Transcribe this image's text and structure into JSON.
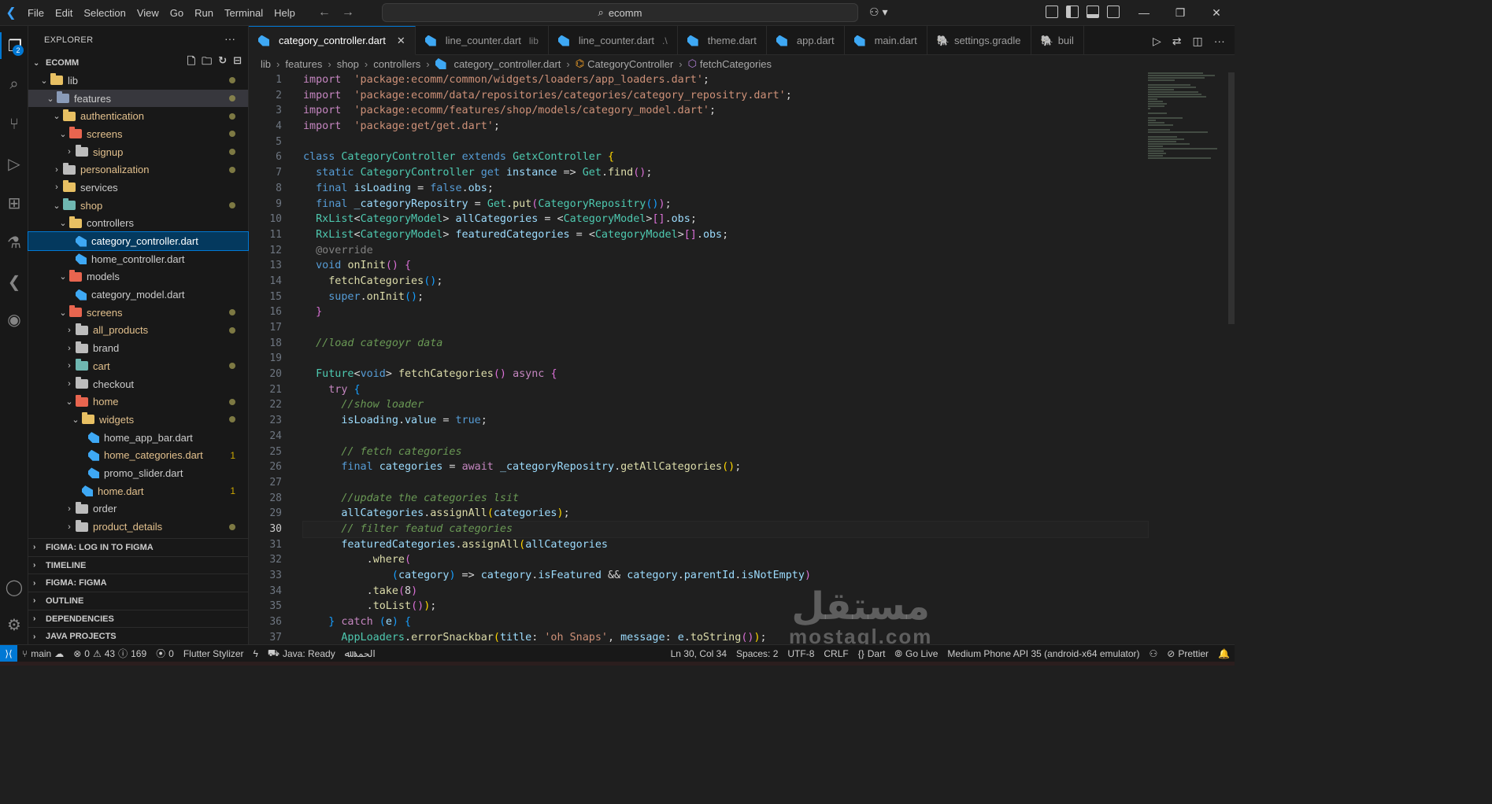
{
  "menu": [
    "File",
    "Edit",
    "Selection",
    "View",
    "Go",
    "Run",
    "Terminal",
    "Help"
  ],
  "search": {
    "text": "ecomm"
  },
  "explorer": {
    "title": "EXPLORER",
    "root": "ECOMM",
    "tree": [
      {
        "label": "lib",
        "type": "folder",
        "depth": 1,
        "open": true,
        "color": "#e8c063",
        "dot": true
      },
      {
        "label": "features",
        "type": "folder",
        "depth": 2,
        "open": true,
        "color": "#8a9bb8",
        "dot": true,
        "hl": true
      },
      {
        "label": "authentication",
        "type": "folder",
        "depth": 3,
        "open": true,
        "color": "#e8c063",
        "dot": true,
        "yellow": true
      },
      {
        "label": "screens",
        "type": "folder",
        "depth": 4,
        "open": true,
        "color": "#e8654f",
        "dot": true,
        "yellow": true
      },
      {
        "label": "signup",
        "type": "folder",
        "depth": 5,
        "open": false,
        "color": "#bcbcbc",
        "dot": true,
        "yellow": true
      },
      {
        "label": "personalization",
        "type": "folder",
        "depth": 3,
        "open": false,
        "color": "#bcbcbc",
        "dot": true,
        "yellow": true
      },
      {
        "label": "services",
        "type": "folder",
        "depth": 3,
        "open": false,
        "color": "#e8c063",
        "dot": false
      },
      {
        "label": "shop",
        "type": "folder",
        "depth": 3,
        "open": true,
        "color": "#6fb7b1",
        "dot": true,
        "yellow": true
      },
      {
        "label": "controllers",
        "type": "folder",
        "depth": 4,
        "open": true,
        "color": "#e8c063",
        "dot": false
      },
      {
        "label": "category_controller.dart",
        "type": "file",
        "depth": 5,
        "selected": true
      },
      {
        "label": "home_controller.dart",
        "type": "file",
        "depth": 5
      },
      {
        "label": "models",
        "type": "folder",
        "depth": 4,
        "open": true,
        "color": "#e8654f",
        "dot": false
      },
      {
        "label": "category_model.dart",
        "type": "file",
        "depth": 5
      },
      {
        "label": "screens",
        "type": "folder",
        "depth": 4,
        "open": true,
        "color": "#e8654f",
        "dot": true,
        "yellow": true
      },
      {
        "label": "all_products",
        "type": "folder",
        "depth": 5,
        "open": false,
        "color": "#bcbcbc",
        "dot": true,
        "yellow": true
      },
      {
        "label": "brand",
        "type": "folder",
        "depth": 5,
        "open": false,
        "color": "#bcbcbc",
        "dot": false
      },
      {
        "label": "cart",
        "type": "folder",
        "depth": 5,
        "open": false,
        "color": "#6fb7b1",
        "dot": true,
        "yellow": true
      },
      {
        "label": "checkout",
        "type": "folder",
        "depth": 5,
        "open": false,
        "color": "#bcbcbc",
        "dot": false
      },
      {
        "label": "home",
        "type": "folder",
        "depth": 5,
        "open": true,
        "color": "#e8654f",
        "dot": true,
        "yellow": true
      },
      {
        "label": "widgets",
        "type": "folder",
        "depth": 6,
        "open": true,
        "color": "#e8c063",
        "dot": true,
        "yellow": true
      },
      {
        "label": "home_app_bar.dart",
        "type": "file",
        "depth": 7
      },
      {
        "label": "home_categories.dart",
        "type": "file",
        "depth": 7,
        "count": "1",
        "yellow": true
      },
      {
        "label": "promo_slider.dart",
        "type": "file",
        "depth": 7
      },
      {
        "label": "home.dart",
        "type": "file",
        "depth": 6,
        "count": "1",
        "yellow": true
      },
      {
        "label": "order",
        "type": "folder",
        "depth": 5,
        "open": false,
        "color": "#bcbcbc",
        "dot": false
      },
      {
        "label": "product_details",
        "type": "folder",
        "depth": 5,
        "open": false,
        "color": "#bcbcbc",
        "dot": true,
        "yellow": true
      }
    ],
    "sections": [
      "FIGMA: LOG IN TO FIGMA",
      "TIMELINE",
      "FIGMA: FIGMA",
      "OUTLINE",
      "DEPENDENCIES",
      "JAVA PROJECTS"
    ]
  },
  "activity_badge": "2",
  "tabs": [
    {
      "label": "category_controller.dart",
      "active": true,
      "icon": "dart"
    },
    {
      "label": "line_counter.dart",
      "desc": "lib",
      "icon": "dart"
    },
    {
      "label": "line_counter.dart",
      "desc": ".\\",
      "icon": "dart"
    },
    {
      "label": "theme.dart",
      "icon": "dart"
    },
    {
      "label": "app.dart",
      "icon": "dart"
    },
    {
      "label": "main.dart",
      "icon": "dart"
    },
    {
      "label": "settings.gradle",
      "icon": "gradle"
    },
    {
      "label": "buil",
      "icon": "gradle"
    }
  ],
  "breadcrumb": [
    "lib",
    "features",
    "shop",
    "controllers",
    "category_controller.dart",
    "CategoryController",
    "fetchCategories"
  ],
  "code": {
    "current_line": 30,
    "lines": [
      [
        [
          "kw2",
          "import"
        ],
        [
          "",
          "  "
        ],
        [
          "str",
          "'package:ecomm/common/widgets/loaders/app_loaders.dart'"
        ],
        [
          "",
          ";"
        ]
      ],
      [
        [
          "kw2",
          "import"
        ],
        [
          "",
          "  "
        ],
        [
          "str",
          "'package:ecomm/data/repositories/categories/category_repositry.dart'"
        ],
        [
          "",
          ";"
        ]
      ],
      [
        [
          "kw2",
          "import"
        ],
        [
          "",
          "  "
        ],
        [
          "str",
          "'package:ecomm/features/shop/models/category_model.dart'"
        ],
        [
          "",
          ";"
        ]
      ],
      [
        [
          "kw2",
          "import"
        ],
        [
          "",
          "  "
        ],
        [
          "str",
          "'package:get/get.dart'"
        ],
        [
          "",
          ";"
        ]
      ],
      [],
      [
        [
          "kw",
          "class"
        ],
        [
          "",
          " "
        ],
        [
          "ty",
          "CategoryController"
        ],
        [
          "",
          " "
        ],
        [
          "kw",
          "extends"
        ],
        [
          "",
          " "
        ],
        [
          "ty",
          "GetxController"
        ],
        [
          "",
          " "
        ],
        [
          "br1",
          "{"
        ]
      ],
      [
        [
          "",
          "  "
        ],
        [
          "kw",
          "static"
        ],
        [
          "",
          " "
        ],
        [
          "ty",
          "CategoryController"
        ],
        [
          "",
          " "
        ],
        [
          "kw",
          "get"
        ],
        [
          "",
          " "
        ],
        [
          "vr",
          "instance"
        ],
        [
          "",
          " => "
        ],
        [
          "ty",
          "Get"
        ],
        [
          "",
          "."
        ],
        [
          "fn",
          "find"
        ],
        [
          "br2",
          "()"
        ],
        [
          "",
          ";"
        ]
      ],
      [
        [
          "",
          "  "
        ],
        [
          "kw",
          "final"
        ],
        [
          "",
          " "
        ],
        [
          "vr",
          "isLoading"
        ],
        [
          "",
          " = "
        ],
        [
          "kw",
          "false"
        ],
        [
          "",
          "."
        ],
        [
          "vr",
          "obs"
        ],
        [
          "",
          ";"
        ]
      ],
      [
        [
          "",
          "  "
        ],
        [
          "kw",
          "final"
        ],
        [
          "",
          " "
        ],
        [
          "vr",
          "_categoryRepositry"
        ],
        [
          "",
          " = "
        ],
        [
          "ty",
          "Get"
        ],
        [
          "",
          "."
        ],
        [
          "fn",
          "put"
        ],
        [
          "br2",
          "("
        ],
        [
          "ty",
          "CategoryRepositry"
        ],
        [
          "br3",
          "()"
        ],
        [
          "br2",
          ")"
        ],
        [
          "",
          ";"
        ]
      ],
      [
        [
          "",
          "  "
        ],
        [
          "ty",
          "RxList"
        ],
        [
          "",
          "<"
        ],
        [
          "ty",
          "CategoryModel"
        ],
        [
          "",
          "> "
        ],
        [
          "vr",
          "allCategories"
        ],
        [
          "",
          " = "
        ],
        [
          "",
          "<"
        ],
        [
          "ty",
          "CategoryModel"
        ],
        [
          "",
          ">"
        ],
        [
          "br2",
          "[]"
        ],
        [
          "",
          "."
        ],
        [
          "vr",
          "obs"
        ],
        [
          "",
          ";"
        ]
      ],
      [
        [
          "",
          "  "
        ],
        [
          "ty",
          "RxList"
        ],
        [
          "",
          "<"
        ],
        [
          "ty",
          "CategoryModel"
        ],
        [
          "",
          "> "
        ],
        [
          "vr",
          "featuredCategories"
        ],
        [
          "",
          " = "
        ],
        [
          "",
          "<"
        ],
        [
          "ty",
          "CategoryModel"
        ],
        [
          "",
          ">"
        ],
        [
          "br2",
          "[]"
        ],
        [
          "",
          "."
        ],
        [
          "vr",
          "obs"
        ],
        [
          "",
          ";"
        ]
      ],
      [
        [
          "",
          "  "
        ],
        [
          "an",
          "@override"
        ]
      ],
      [
        [
          "",
          "  "
        ],
        [
          "kw",
          "void"
        ],
        [
          "",
          " "
        ],
        [
          "fn",
          "onInit"
        ],
        [
          "br2",
          "()"
        ],
        [
          "",
          " "
        ],
        [
          "br2",
          "{"
        ]
      ],
      [
        [
          "",
          "    "
        ],
        [
          "fn",
          "fetchCategories"
        ],
        [
          "br3",
          "()"
        ],
        [
          "",
          ";"
        ]
      ],
      [
        [
          "",
          "    "
        ],
        [
          "kw",
          "super"
        ],
        [
          "",
          "."
        ],
        [
          "fn",
          "onInit"
        ],
        [
          "br3",
          "()"
        ],
        [
          "",
          ";"
        ]
      ],
      [
        [
          "",
          "  "
        ],
        [
          "br2",
          "}"
        ]
      ],
      [],
      [
        [
          "",
          "  "
        ],
        [
          "cm",
          "//load categoyr data"
        ]
      ],
      [],
      [
        [
          "",
          "  "
        ],
        [
          "ty",
          "Future"
        ],
        [
          "",
          "<"
        ],
        [
          "kw",
          "void"
        ],
        [
          "",
          "> "
        ],
        [
          "fn",
          "fetchCategories"
        ],
        [
          "br2",
          "()"
        ],
        [
          "",
          " "
        ],
        [
          "kw2",
          "async"
        ],
        [
          "",
          " "
        ],
        [
          "br2",
          "{"
        ]
      ],
      [
        [
          "",
          "    "
        ],
        [
          "kw2",
          "try"
        ],
        [
          "",
          " "
        ],
        [
          "br3",
          "{"
        ]
      ],
      [
        [
          "",
          "      "
        ],
        [
          "cm",
          "//show loader"
        ]
      ],
      [
        [
          "",
          "      "
        ],
        [
          "vr",
          "isLoading"
        ],
        [
          "",
          "."
        ],
        [
          "vr",
          "value"
        ],
        [
          "",
          " = "
        ],
        [
          "kw",
          "true"
        ],
        [
          "",
          ";"
        ]
      ],
      [],
      [
        [
          "",
          "      "
        ],
        [
          "cm",
          "// fetch categories"
        ]
      ],
      [
        [
          "",
          "      "
        ],
        [
          "kw",
          "final"
        ],
        [
          "",
          " "
        ],
        [
          "vr",
          "categories"
        ],
        [
          "",
          " = "
        ],
        [
          "kw2",
          "await"
        ],
        [
          "",
          " "
        ],
        [
          "vr",
          "_categoryRepositry"
        ],
        [
          "",
          "."
        ],
        [
          "fn",
          "getAllCategories"
        ],
        [
          "br1",
          "()"
        ],
        [
          "",
          ";"
        ]
      ],
      [],
      [
        [
          "",
          "      "
        ],
        [
          "cm",
          "//update the categories lsit"
        ]
      ],
      [
        [
          "",
          "      "
        ],
        [
          "vr",
          "allCategories"
        ],
        [
          "",
          "."
        ],
        [
          "fn",
          "assignAll"
        ],
        [
          "br1",
          "("
        ],
        [
          "vr",
          "categories"
        ],
        [
          "br1",
          ")"
        ],
        [
          "",
          ";"
        ]
      ],
      [
        [
          "",
          "      "
        ],
        [
          "cm",
          "// filter featud categories"
        ]
      ],
      [
        [
          "",
          "      "
        ],
        [
          "vr",
          "featuredCategories"
        ],
        [
          "",
          "."
        ],
        [
          "fn",
          "assignAll"
        ],
        [
          "br1",
          "("
        ],
        [
          "vr",
          "allCategories"
        ]
      ],
      [
        [
          "",
          "          "
        ],
        [
          "",
          "."
        ],
        [
          "fn",
          "where"
        ],
        [
          "br2",
          "("
        ]
      ],
      [
        [
          "",
          "              "
        ],
        [
          "br3",
          "("
        ],
        [
          "vr",
          "category"
        ],
        [
          "br3",
          ")"
        ],
        [
          "",
          " => "
        ],
        [
          "vr",
          "category"
        ],
        [
          "",
          "."
        ],
        [
          "vr",
          "isFeatured"
        ],
        [
          "",
          " && "
        ],
        [
          "vr",
          "category"
        ],
        [
          "",
          "."
        ],
        [
          "vr",
          "parentId"
        ],
        [
          "",
          "."
        ],
        [
          "vr",
          "isNotEmpty"
        ],
        [
          "br2",
          ")"
        ]
      ],
      [
        [
          "",
          "          "
        ],
        [
          "",
          "."
        ],
        [
          "fn",
          "take"
        ],
        [
          "br2",
          "("
        ],
        [
          "",
          "8"
        ],
        [
          "br2",
          ")"
        ]
      ],
      [
        [
          "",
          "          "
        ],
        [
          "",
          "."
        ],
        [
          "fn",
          "toList"
        ],
        [
          "br2",
          "()"
        ],
        [
          "br1",
          ")"
        ],
        [
          "",
          ";"
        ]
      ],
      [
        [
          "",
          "    "
        ],
        [
          "br3",
          "}"
        ],
        [
          "",
          " "
        ],
        [
          "kw2",
          "catch"
        ],
        [
          "",
          " "
        ],
        [
          "br3",
          "("
        ],
        [
          "vr",
          "e"
        ],
        [
          "br3",
          ")"
        ],
        [
          "",
          " "
        ],
        [
          "br3",
          "{"
        ]
      ],
      [
        [
          "",
          "      "
        ],
        [
          "ty",
          "AppLoaders"
        ],
        [
          "",
          "."
        ],
        [
          "fn",
          "errorSnackbar"
        ],
        [
          "br1",
          "("
        ],
        [
          "vr",
          "title"
        ],
        [
          "",
          ": "
        ],
        [
          "str",
          "'oh Snaps'"
        ],
        [
          "",
          ", "
        ],
        [
          "vr",
          "message"
        ],
        [
          "",
          ": "
        ],
        [
          "vr",
          "e"
        ],
        [
          "",
          "."
        ],
        [
          "fn",
          "toString"
        ],
        [
          "br2",
          "()"
        ],
        [
          "br1",
          ")"
        ],
        [
          "",
          ";"
        ]
      ]
    ]
  },
  "status": {
    "branch": "main",
    "errors": "0",
    "warnings": "43",
    "info": "169",
    "ports": "0",
    "flutter_stylizer": "Flutter Stylizer",
    "java": "Java: Ready",
    "arabic": "الحمد",
    "position": "Ln 30, Col 34",
    "spaces": "Spaces: 2",
    "encoding": "UTF-8",
    "eol": "CRLF",
    "language": "Dart",
    "golive": "Go Live",
    "device": "Medium Phone API 35 (android-x64 emulator)",
    "prettier": "Prettier"
  },
  "watermark": {
    "main": "مستقل",
    "sub": "mostaql.com"
  }
}
